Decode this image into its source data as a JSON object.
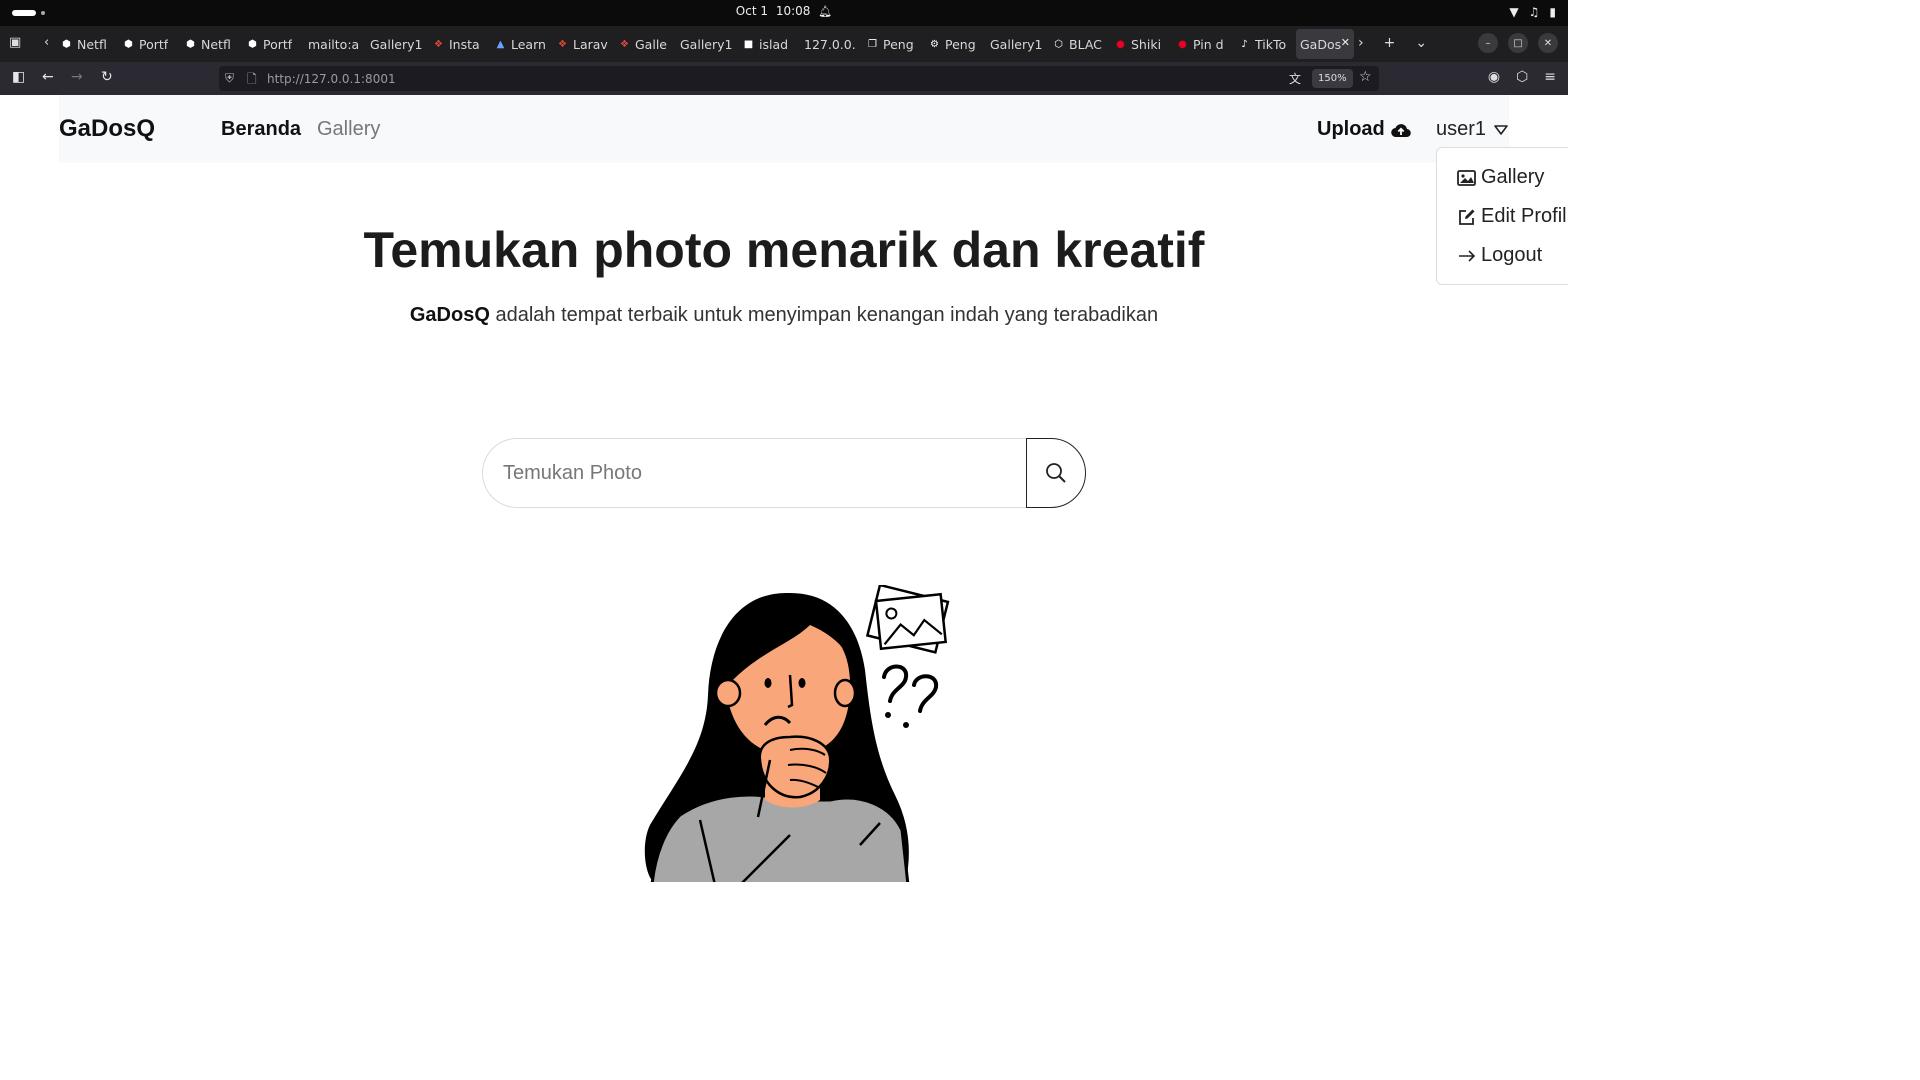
{
  "os": {
    "date": "Oct 1",
    "time": "10:08"
  },
  "browser": {
    "tabs": [
      {
        "label": "Netfl",
        "icon": "netflix-icon"
      },
      {
        "label": "Portf",
        "icon": "portfolio-icon"
      },
      {
        "label": "Netfl",
        "icon": "netflix-icon"
      },
      {
        "label": "Portf",
        "icon": "portfolio-icon"
      },
      {
        "label": "mailto:a",
        "icon": ""
      },
      {
        "label": "Gallery1",
        "icon": ""
      },
      {
        "label": "Insta",
        "icon": "laravel-icon"
      },
      {
        "label": "Learn",
        "icon": "learn-icon"
      },
      {
        "label": "Larav",
        "icon": "laravel-icon"
      },
      {
        "label": "Galle",
        "icon": "laravel-icon"
      },
      {
        "label": "Gallery1",
        "icon": ""
      },
      {
        "label": "islad",
        "icon": "cube-icon"
      },
      {
        "label": "127.0.0.",
        "icon": ""
      },
      {
        "label": "Peng",
        "icon": "doc-icon"
      },
      {
        "label": "Peng",
        "icon": "gear-icon"
      },
      {
        "label": "Gallery1",
        "icon": ""
      },
      {
        "label": "BLAC",
        "icon": "hex-icon"
      },
      {
        "label": "Shiki",
        "icon": "pinterest-icon"
      },
      {
        "label": "Pin d",
        "icon": "pinterest-icon"
      },
      {
        "label": "TikTo",
        "icon": "tiktok-icon"
      },
      {
        "label": "GaDos",
        "icon": "",
        "active": true
      }
    ],
    "url": "http://127.0.0.1:8001",
    "zoom": "150%"
  },
  "site": {
    "brand": "GaDosQ",
    "nav": {
      "home": "Beranda",
      "gallery": "Gallery"
    },
    "upload_label": "Upload",
    "user_label": "user1",
    "dropdown": {
      "gallery": "Gallery",
      "edit_profile": "Edit Profil",
      "logout": "Logout"
    }
  },
  "hero": {
    "title": "Temukan photo menarik dan kreatif",
    "subtitle_brand": "GaDosQ",
    "subtitle_rest": " adalah tempat terbaik untuk menyimpan kenangan indah yang terabadikan"
  },
  "search": {
    "placeholder": "Temukan Photo"
  },
  "colors": {
    "navbar_bg": "#f8f9fa",
    "skin": "#f9a77a",
    "shirt": "#a7a7a7",
    "hair": "#000000"
  }
}
